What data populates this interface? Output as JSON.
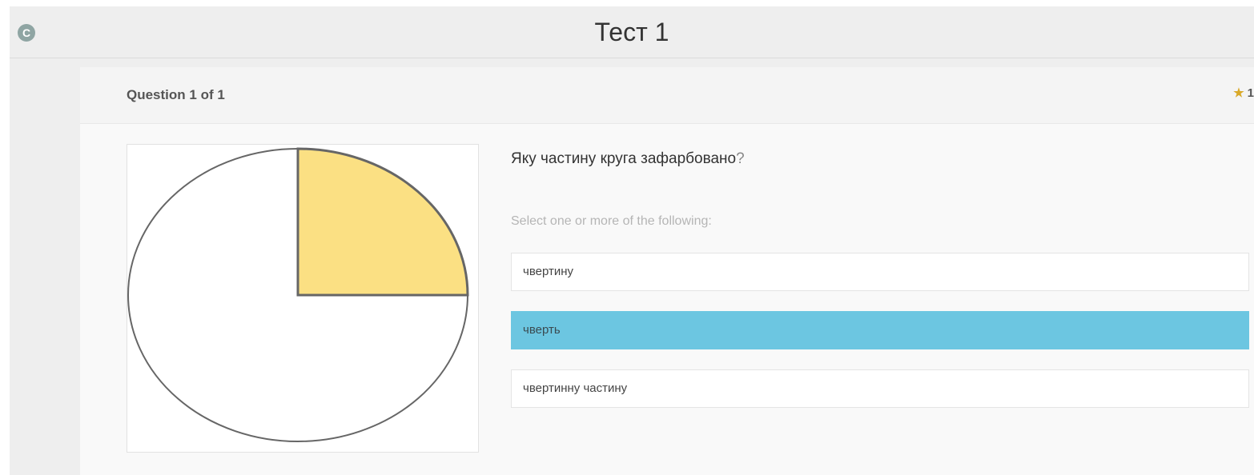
{
  "header": {
    "title": "Тест 1",
    "logo_letter": "C"
  },
  "quiz": {
    "question_counter": "Question 1 of 1",
    "points": "1",
    "question_text": "Яку частину круга зафарбовано",
    "question_mark": "?",
    "instruction": "Select one or more of the following:",
    "options": [
      {
        "label": "чвертину",
        "selected": false
      },
      {
        "label": "чверть",
        "selected": true
      },
      {
        "label": "чвертинну частину",
        "selected": false
      }
    ]
  },
  "figure": {
    "shaded_fraction": 0.25,
    "shaded_color": "#fbe083",
    "outline_color": "#666666"
  },
  "colors": {
    "selected_option": "#6cc6e1",
    "background": "#eeeeee"
  }
}
